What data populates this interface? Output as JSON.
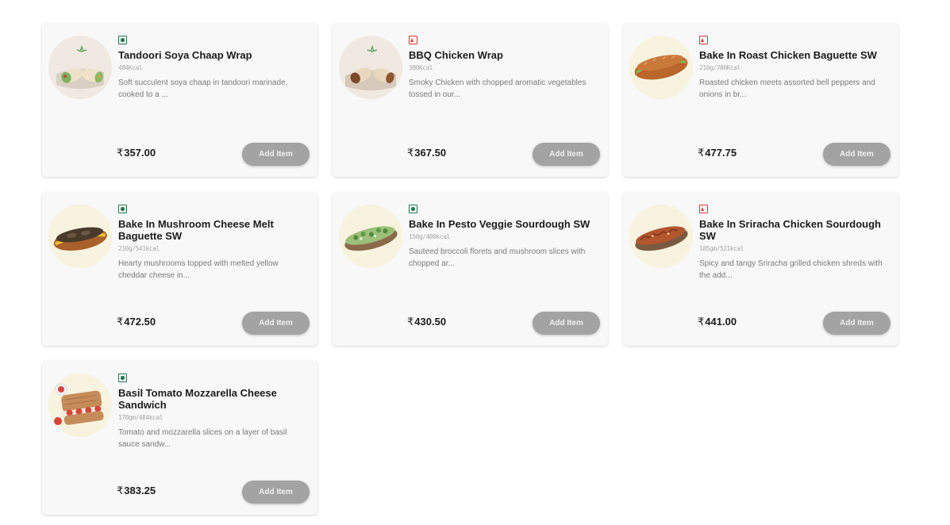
{
  "currency_symbol": "₹",
  "add_label": "Add Item",
  "items": [
    {
      "name": "Tandoori Soya Chaap Wrap",
      "diet": "veg",
      "cal": "484Kcal",
      "desc": "Soft succulent soya chaap in tandoori marinade, cooked to a ...",
      "price": "357.00",
      "image": "wrap-veg"
    },
    {
      "name": "BBQ Chicken Wrap",
      "diet": "nonveg",
      "cal": "380Kcal",
      "desc": "Smoky Chicken with chopped aromatic vegetables tossed in our...",
      "price": "367.50",
      "image": "wrap-chicken"
    },
    {
      "name": "Bake In Roast Chicken Baguette SW",
      "diet": "nonveg",
      "cal": "210g/706Kcal",
      "desc": "Roasted chicken meets assorted bell peppers and onions in br...",
      "price": "477.75",
      "image": "baguette"
    },
    {
      "name": "Bake In Mushroom Cheese Melt Baguette SW",
      "diet": "veg",
      "cal": "210g/541kcal",
      "desc": "Hearty mushrooms topped with melted yellow cheddar cheese in...",
      "price": "472.50",
      "image": "baguette-mushroom"
    },
    {
      "name": "Bake In Pesto Veggie Sourdough SW",
      "diet": "veg",
      "cal": "150g/400kcal",
      "desc": "Sauteed broccoli florets and mushroom slices with chopped ar...",
      "price": "430.50",
      "image": "sourdough-pesto"
    },
    {
      "name": "Bake In Sriracha Chicken Sourdough SW",
      "diet": "nonveg",
      "cal": "185gm/521kcal",
      "desc": "Spicy and tangy Sriracha grilled chicken shreds with the add...",
      "price": "441.00",
      "image": "sourdough-sriracha"
    },
    {
      "name": " Basil Tomato Mozzarella Cheese Sandwich",
      "diet": "veg",
      "cal": "170gm/484kcal",
      "desc": "Tomato and mozzarella slices on a layer of basil sauce sandw...",
      "price": "383.25",
      "image": "sandwich"
    }
  ]
}
